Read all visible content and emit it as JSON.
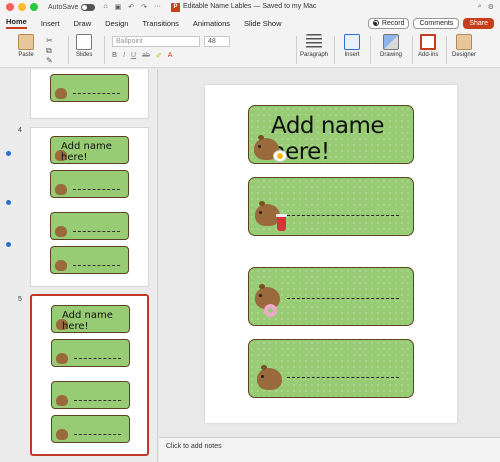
{
  "titlebar": {
    "autosave_label": "AutoSave",
    "doc_title": "Editable Name Lables — Saved to my Mac",
    "file_badge": "P",
    "lights": [
      "#ff5f57",
      "#febc2e",
      "#28c840"
    ]
  },
  "tabs": [
    "Home",
    "Insert",
    "Draw",
    "Design",
    "Transitions",
    "Animations",
    "Slide Show"
  ],
  "actions": {
    "record": "Record",
    "comments": "Comments",
    "share": "Share"
  },
  "ribbon": {
    "paste": "Paste",
    "slides": "Slides",
    "font_name": "Ballpoint",
    "font_size": "48",
    "paragraph": "Paragraph",
    "insert": "Insert",
    "drawing": "Drawing",
    "addins": "Add-ins",
    "designer": "Designer"
  },
  "thumbnails": {
    "slide4_number": "4",
    "slide5_number": "5",
    "mini_text": "Add name here!"
  },
  "slide": {
    "label_title": "Add name here!"
  },
  "notes": {
    "placeholder": "Click to add notes"
  },
  "colors": {
    "accent": "#c43e1c",
    "label_green": "#97cc74",
    "label_border": "#5d4222",
    "selection": "#c0392b"
  }
}
